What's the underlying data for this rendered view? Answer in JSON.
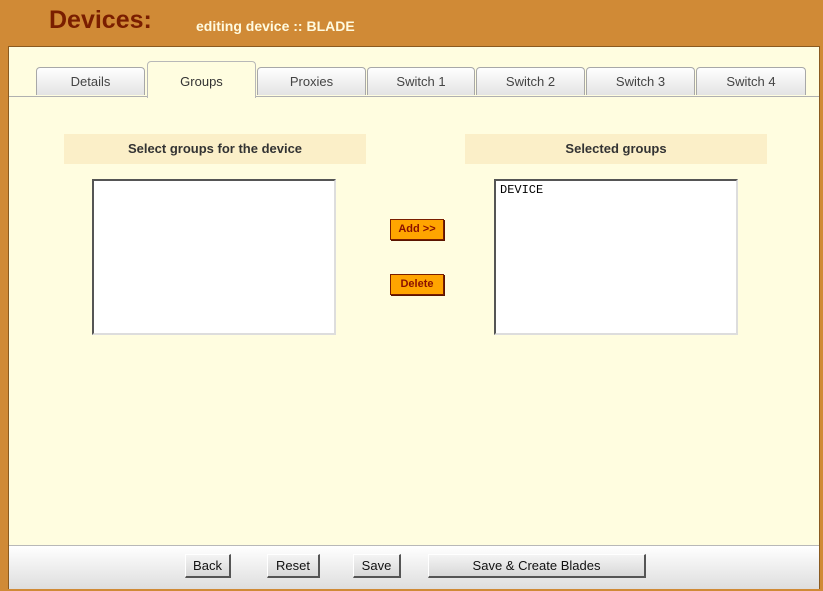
{
  "header": {
    "title": "Devices:",
    "subtitle": "editing device :: BLADE"
  },
  "tabs": [
    {
      "label": "Details",
      "active": false
    },
    {
      "label": "Groups",
      "active": true
    },
    {
      "label": "Proxies",
      "active": false
    },
    {
      "label": "Switch 1",
      "active": false
    },
    {
      "label": "Switch 2",
      "active": false
    },
    {
      "label": "Switch 3",
      "active": false
    },
    {
      "label": "Switch 4",
      "active": false
    }
  ],
  "available_groups": {
    "header": "Select groups for the device",
    "items": []
  },
  "selected_groups": {
    "header": "Selected groups",
    "items": [
      "DEVICE"
    ]
  },
  "actions": {
    "add_label": "Add >>",
    "delete_label": "Delete"
  },
  "footer": {
    "back_label": "Back",
    "reset_label": "Reset",
    "save_label": "Save",
    "save_create_label": "Save & Create Blades"
  },
  "colors": {
    "frame": "#d08a36",
    "title": "#7a1e00",
    "panel_bg": "#fffde0",
    "column_header_bg": "#fbefc8",
    "action_button": "#ffa500"
  }
}
